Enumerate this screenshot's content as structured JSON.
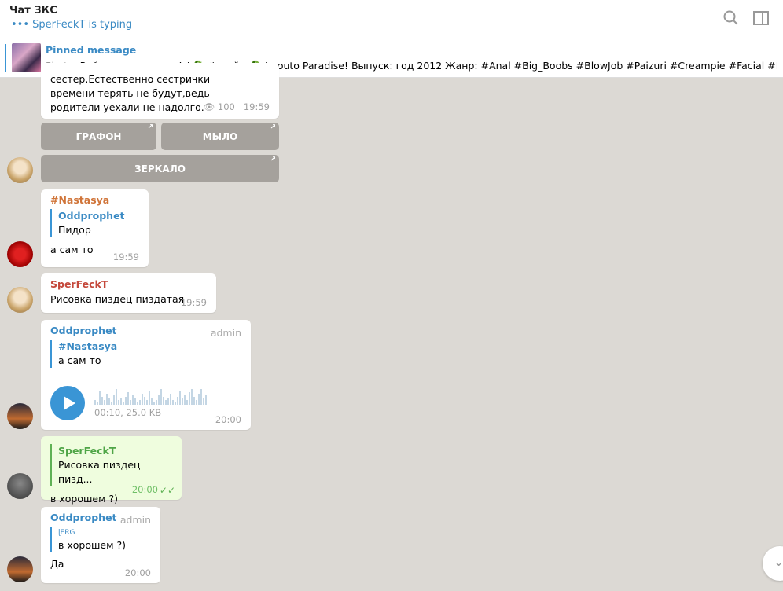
{
  "header": {
    "title": "Чат ЗКС",
    "typing": "••• SperFeckT is typing"
  },
  "pinned": {
    "title": "Pinned message",
    "prefix": "Photo, ",
    "text": "Райские сестрички! / ♻️ #слайд ♻️ Imouto Paradise!  Выпуск: год 2012 Жанр: #Anal #Big_Boobs #BlowJob #Paizuri #Creampie #Facial #FootJo..."
  },
  "messages": [
    {
      "text": "сестер.Естественно сестрички времени терять не будут,ведь родители уехали не надолго.",
      "views": "100",
      "time": "19:59",
      "buttons": [
        "ГРАФОН",
        "МЫЛО",
        "ЗЕРКАЛО"
      ]
    },
    {
      "author": "#Nastasya",
      "reply_author": "Oddprophet",
      "reply_text": "Пидор",
      "text": "а сам то",
      "time": "19:59"
    },
    {
      "author": "SperFeckT",
      "text": "Рисовка пиздец пиздатая",
      "time": "19:59"
    },
    {
      "author": "Oddprophet",
      "badge": "admin",
      "reply_author": "#Nastasya",
      "reply_text": "а сам то",
      "voice_info": "00:10, 25.0 KB",
      "time": "20:00"
    },
    {
      "reply_author": "SperFeckT",
      "reply_text": "Рисовка пиздец пизд...",
      "text": "в хорошем ?)",
      "time": "20:00"
    },
    {
      "author": "Oddprophet",
      "badge": "admin",
      "reply_author": "ɭERG",
      "reply_text": "в хорошем ?)",
      "text": "Да",
      "time": "20:00"
    }
  ],
  "colors": {
    "accent": "#3a95d5",
    "nastasya": "#d0753a",
    "sperfeckt": "#c4473a",
    "oddprophet": "#3a8ac4"
  }
}
